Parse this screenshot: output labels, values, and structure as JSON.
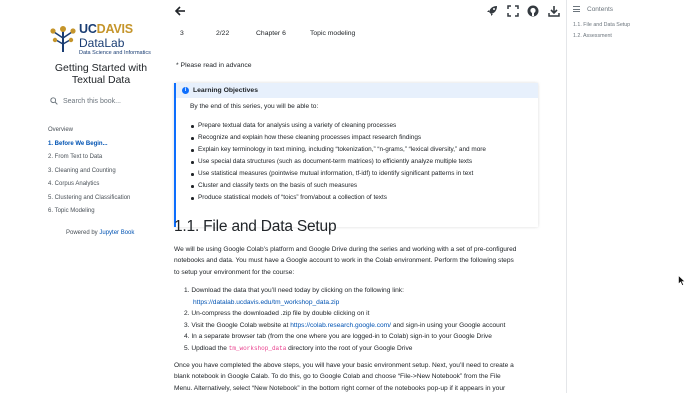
{
  "logo": {
    "uc": "UC",
    "davis": "DAVIS",
    "lab": "DataLab",
    "sub": "Data Science and Informatics"
  },
  "book_title": "Getting Started with Textual Data",
  "search": {
    "placeholder": "Search this book..."
  },
  "nav": [
    {
      "label": "Overview",
      "active": false
    },
    {
      "label": "1. Before We Begin...",
      "active": true
    },
    {
      "label": "2. From Text to Data",
      "active": false
    },
    {
      "label": "3. Cleaning and Counting",
      "active": false
    },
    {
      "label": "4. Corpus Analytics",
      "active": false
    },
    {
      "label": "5. Clustering and Classification",
      "active": false
    },
    {
      "label": "6. Topic Modeling",
      "active": false
    }
  ],
  "powered": {
    "prefix": "Powered by ",
    "link": "Jupyter Book"
  },
  "topbar": {
    "icons": [
      "back-arrow-icon",
      "rocket-icon",
      "fullscreen-icon",
      "github-icon",
      "download-icon",
      "contents-icon"
    ]
  },
  "contents": {
    "header": "Contents",
    "items": [
      "1.1. File and Data Setup",
      "1.2. Assessment"
    ]
  },
  "schedule_row": {
    "num": "3",
    "date": "2/22",
    "chapter": "Chapter 6",
    "topic": "Topic modeling"
  },
  "advance_note": "* Please read in advance",
  "objectives": {
    "title": "Learning Objectives",
    "intro": "By the end of this series, you will be able to:",
    "items": [
      "Prepare textual data for analysis using a variety of cleaning processes",
      "Recognize and explain how these cleaning processes impact research findings",
      "Explain key terminology in text mining, including “tokenization,” “n-grams,” “lexical diversity,” and more",
      "Use special data structures (such as document-term matrices) to efficiently analyze multiple texts",
      "Use statistical measures (pointwise mutual information, tf-idf) to identify significant patterns in text",
      "Cluster and classify texts on the basis of such measures",
      "Produce statistical models of “toics” from/about a collection of texts"
    ]
  },
  "section": {
    "heading": "1.1. File and Data Setup",
    "intro_lines": [
      "We will be using Google Colab’s platform and Google Drive during the series and working with a set of pre-configured",
      "notebooks and data. You must have a Google account to work in the Colab environment. Perform the following steps",
      "to setup your environment for the course:"
    ],
    "steps": {
      "s1": "1. Download the data that you’ll need today by clicking on the following link:",
      "s1_link": "https://datalab.ucdavis.edu/tm_workshop_data.zip",
      "s2": "2. Un-compress the downloaded .zip file by double clicking on it",
      "s3_pre": "3. Visit the Google Colab website at ",
      "s3_link": "https://colab.research.google.com/",
      "s3_post": " and sign-in using your Google account",
      "s4": "4. In a separate browser tab (from the one where you are logged-in to Colab) sign-in to your Google Drive",
      "s5_pre": "5. Updload the ",
      "s5_code": "tm_workshop_data",
      "s5_post": " directory into the root of your Google Drive"
    },
    "outro_lines": [
      "Once you have completed the above steps, you will have your basic environment setup. Next, you’ll need to create a",
      "blank notebook in Google Calab. To do this, go to Google Colab and choose “File->New Notebook” from the File",
      "Menu. Alternatively, select “New Notebook” in the bottom right corner of the notebooks pop-up if it appears in your"
    ]
  },
  "colors": {
    "accent": "#0053b3",
    "admonition": "#0d6efd",
    "admonition_bg": "#e7f0fc",
    "code": "#e83e8c"
  }
}
